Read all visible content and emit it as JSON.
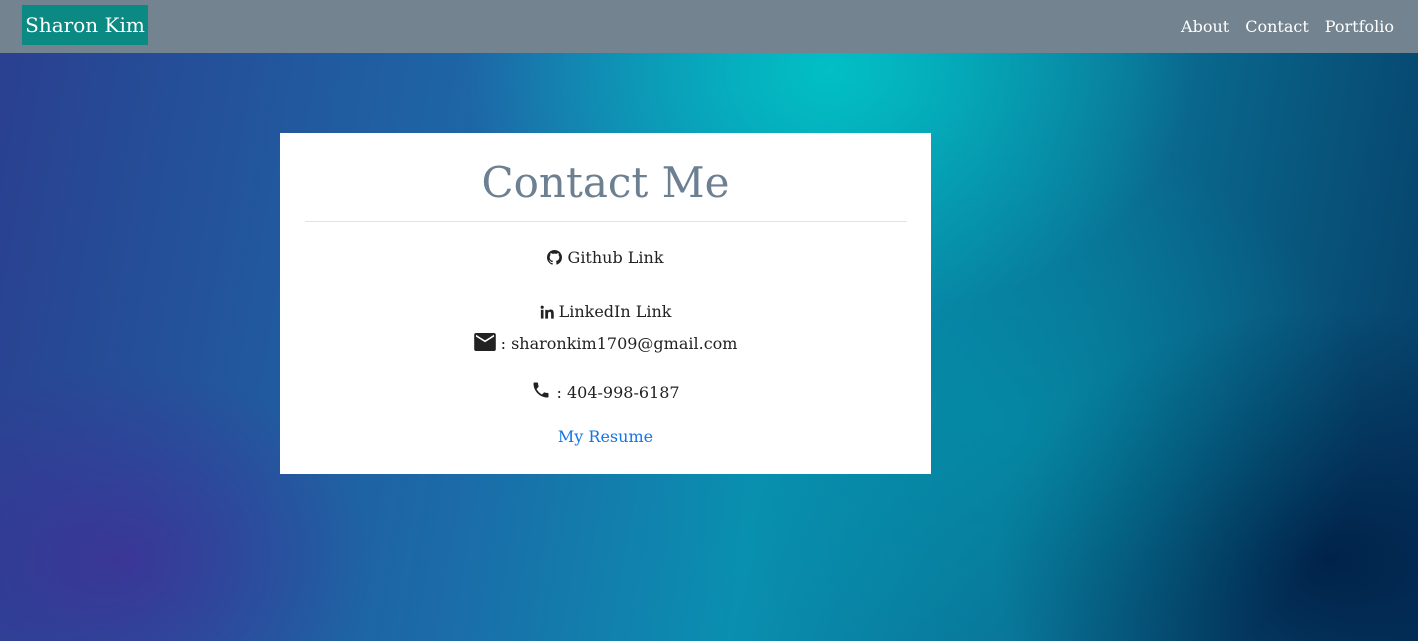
{
  "navbar": {
    "brand": "Sharon Kim",
    "links": [
      {
        "label": "About"
      },
      {
        "label": "Contact"
      },
      {
        "label": "Portfolio"
      }
    ]
  },
  "card": {
    "title": "Contact Me",
    "github": {
      "icon": "github-icon",
      "label": "Github Link"
    },
    "linkedin": {
      "icon": "linkedin-icon",
      "label": "LinkedIn Link"
    },
    "email": {
      "icon": "mail-icon",
      "text": ": sharonkim1709@gmail.com"
    },
    "phone": {
      "icon": "phone-icon",
      "text": ": 404-998-6187"
    },
    "resume": {
      "label": "My Resume"
    }
  },
  "colors": {
    "navbar": "#73838f",
    "brand": "#0a8a82",
    "title": "#6c8092",
    "link": "#1473e6"
  }
}
